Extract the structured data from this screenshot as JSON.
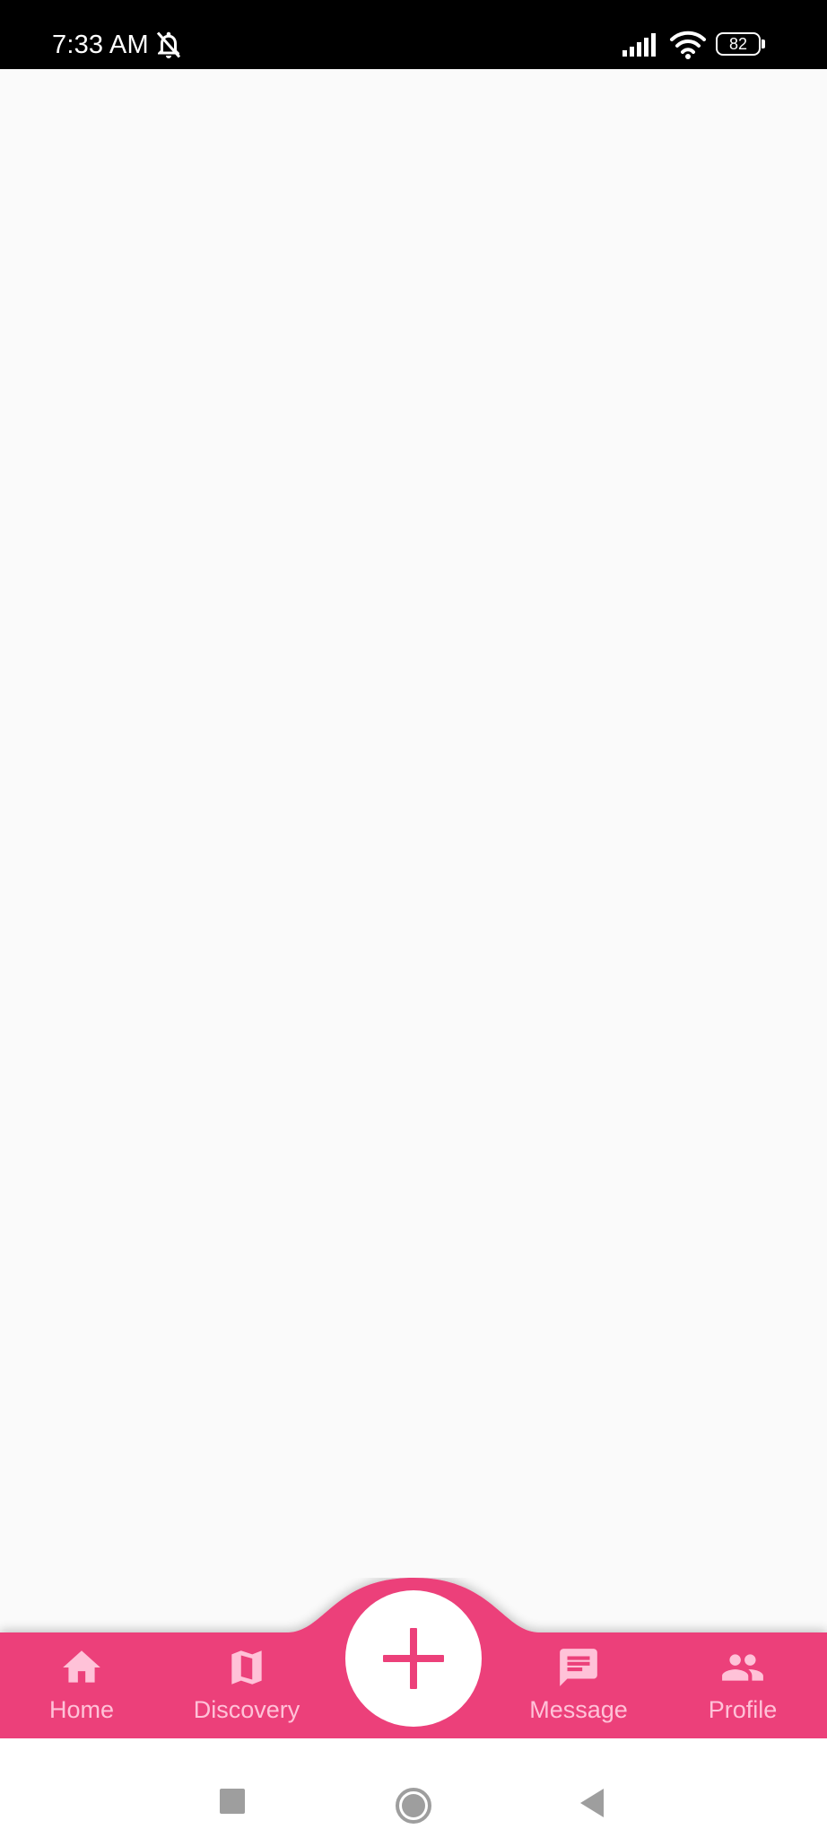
{
  "status_bar": {
    "time": "7:33 AM",
    "battery_level": "82",
    "icons": [
      "bell-off-icon",
      "signal-icon",
      "wifi-icon",
      "battery-icon"
    ]
  },
  "bottom_nav": {
    "accent_color": "#ec407a",
    "label_color": "#ffc2d8",
    "items": [
      {
        "label": "Home",
        "icon": "home-icon"
      },
      {
        "label": "Discovery",
        "icon": "map-icon"
      },
      {
        "label": "Message",
        "icon": "message-icon"
      },
      {
        "label": "Profile",
        "icon": "people-icon"
      }
    ],
    "center_action": {
      "icon": "plus-icon"
    }
  },
  "system_nav": {
    "buttons": [
      "recents-button",
      "home-button",
      "back-button"
    ]
  }
}
